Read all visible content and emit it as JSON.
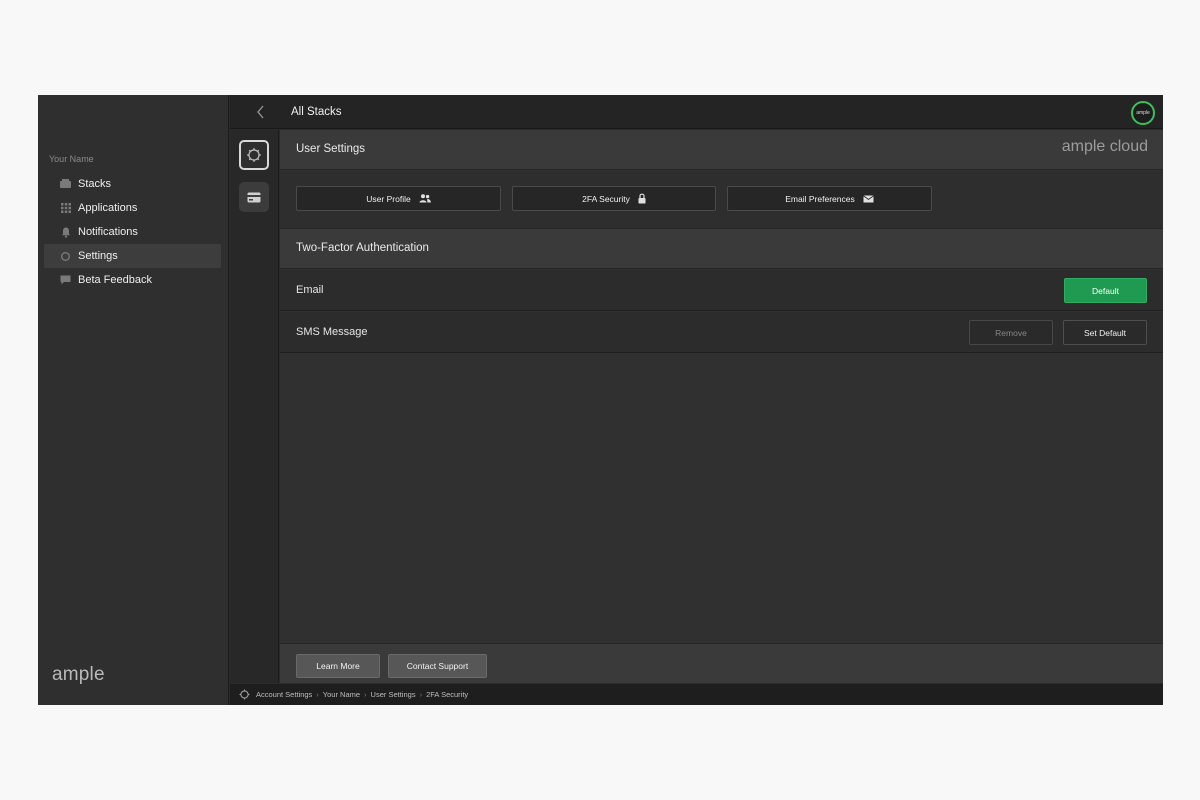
{
  "sidebar": {
    "user_name": "Your Name",
    "items": [
      {
        "label": "Stacks",
        "icon": "stacks-icon"
      },
      {
        "label": "Applications",
        "icon": "grid-icon"
      },
      {
        "label": "Notifications",
        "icon": "bell-icon"
      },
      {
        "label": "Settings",
        "icon": "gear-icon",
        "active": true
      },
      {
        "label": "Beta Feedback",
        "icon": "chat-icon"
      }
    ],
    "brand": "ample"
  },
  "topbar": {
    "title": "All Stacks",
    "avatar_text": "ample",
    "avatar_ring_color": "#39c25a"
  },
  "main": {
    "header_title": "User Settings",
    "logo_text": "ample cloud",
    "tabs": [
      {
        "label": "User Profile",
        "icon": "users-icon"
      },
      {
        "label": "2FA Security",
        "icon": "lock-icon"
      },
      {
        "label": "Email Preferences",
        "icon": "envelope-icon"
      }
    ],
    "section_title": "Two-Factor Authentication",
    "methods": [
      {
        "label": "Email",
        "default_label": "Default"
      },
      {
        "label": "SMS Message",
        "remove_label": "Remove",
        "set_default_label": "Set Default"
      }
    ],
    "footer": {
      "learn_more": "Learn More",
      "contact_support": "Contact Support"
    }
  },
  "breadcrumb": [
    "Account Settings",
    "Your Name",
    "User Settings",
    "2FA Security"
  ],
  "colors": {
    "accent_green": "#1f9b51",
    "background": "#2b2b2b"
  }
}
